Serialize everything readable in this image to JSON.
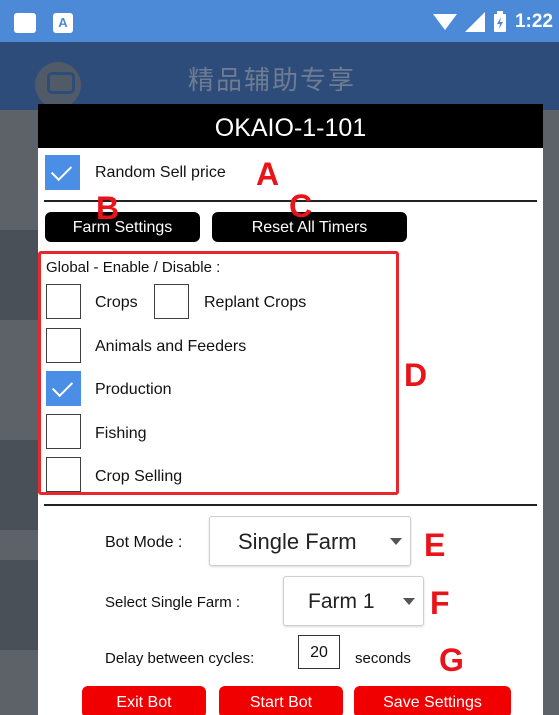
{
  "status_bar": {
    "time": "1:22",
    "app_icon_letter": "A",
    "icons": [
      "wifi-icon",
      "signal-icon",
      "battery-icon"
    ]
  },
  "app_bar": {
    "title": "精品辅助专享"
  },
  "dialog": {
    "title": "OKAIO-1-101",
    "random_sell": {
      "label": "Random Sell price",
      "checked": true,
      "annotation": "A"
    },
    "farm_settings": {
      "label": "Farm Settings",
      "annotation": "B"
    },
    "reset_timers": {
      "label": "Reset All Timers",
      "annotation": "C"
    },
    "global": {
      "heading": "Global - Enable / Disable :",
      "annotation": "D",
      "items": [
        {
          "label": "Crops",
          "checked": false
        },
        {
          "label": "Replant Crops",
          "checked": false
        },
        {
          "label": "Animals and Feeders",
          "checked": false
        },
        {
          "label": "Production",
          "checked": true
        },
        {
          "label": "Fishing",
          "checked": false
        },
        {
          "label": "Crop Selling",
          "checked": false
        }
      ]
    },
    "bot_mode": {
      "label": "Bot Mode :",
      "value": "Single Farm",
      "annotation": "E"
    },
    "single_farm": {
      "label": "Select Single Farm :",
      "value": "Farm 1",
      "annotation": "F"
    },
    "delay": {
      "label": "Delay between cycles:",
      "value": "20",
      "unit": "seconds",
      "annotation": "G"
    },
    "buttons": {
      "exit": "Exit Bot",
      "start": "Start Bot",
      "save": "Save Settings"
    }
  },
  "colors": {
    "accent": "#4a8ee6",
    "red_button": "#f00000",
    "annotation_red": "#e8141a",
    "status_bar": "#4c8ad8"
  }
}
